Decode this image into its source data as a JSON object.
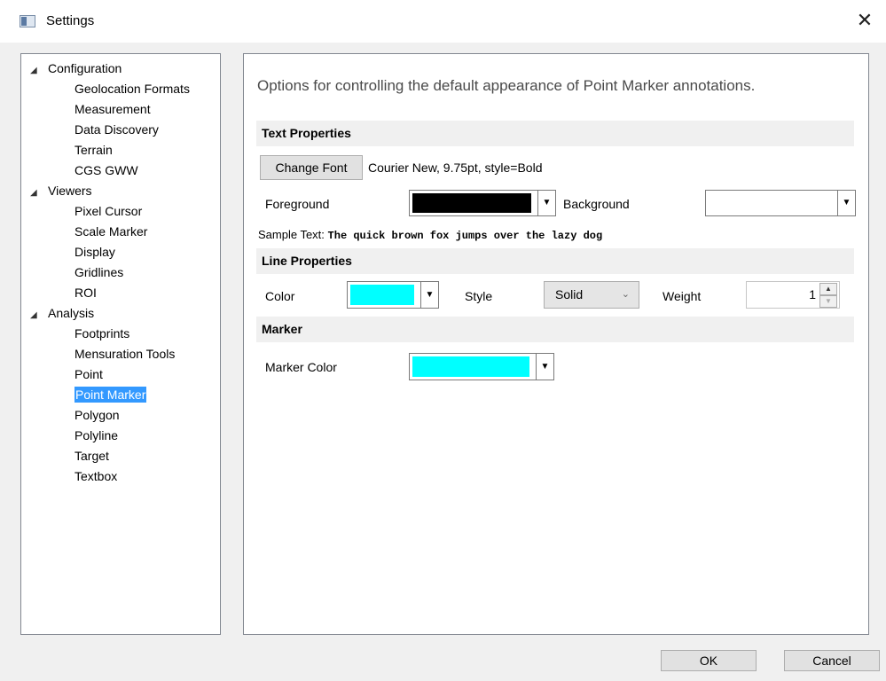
{
  "window": {
    "title": "Settings",
    "close_symbol": "✕"
  },
  "tree": {
    "items": [
      {
        "label": "Configuration",
        "level": 0,
        "expanded": true
      },
      {
        "label": "Geolocation Formats",
        "level": 1
      },
      {
        "label": "Measurement",
        "level": 1
      },
      {
        "label": "Data Discovery",
        "level": 1
      },
      {
        "label": "Terrain",
        "level": 1
      },
      {
        "label": "CGS GWW",
        "level": 1
      },
      {
        "label": "Viewers",
        "level": 0,
        "expanded": true
      },
      {
        "label": "Pixel Cursor",
        "level": 1
      },
      {
        "label": "Scale Marker",
        "level": 1
      },
      {
        "label": "Display",
        "level": 1
      },
      {
        "label": "Gridlines",
        "level": 1
      },
      {
        "label": "ROI",
        "level": 1
      },
      {
        "label": "Analysis",
        "level": 0,
        "expanded": true
      },
      {
        "label": "Footprints",
        "level": 1
      },
      {
        "label": "Mensuration Tools",
        "level": 1
      },
      {
        "label": "Point",
        "level": 1
      },
      {
        "label": "Point Marker",
        "level": 1,
        "selected": true
      },
      {
        "label": "Polygon",
        "level": 1
      },
      {
        "label": "Polyline",
        "level": 1
      },
      {
        "label": "Target",
        "level": 1
      },
      {
        "label": "Textbox",
        "level": 1
      }
    ],
    "expand_glyph": "◢"
  },
  "panel": {
    "description": "Options for controlling the default appearance of Point Marker annotations.",
    "text_properties": {
      "header": "Text Properties",
      "change_font_label": "Change Font",
      "font_info": "Courier New, 9.75pt, style=Bold",
      "foreground_label": "Foreground",
      "foreground_color": "#000000",
      "background_label": "Background",
      "background_color": "#ffffff",
      "sample_label": "Sample Text:",
      "sample_text": "The quick brown fox jumps over the lazy dog"
    },
    "line_properties": {
      "header": "Line Properties",
      "color_label": "Color",
      "color_value": "#00ffff",
      "style_label": "Style",
      "style_value": "Solid",
      "weight_label": "Weight",
      "weight_value": "1"
    },
    "marker": {
      "header": "Marker",
      "color_label": "Marker Color",
      "color_value": "#00ffff"
    }
  },
  "footer": {
    "ok_label": "OK",
    "cancel_label": "Cancel"
  },
  "colors": {
    "selection": "#3399ff",
    "window_bg": "#f0f0f0"
  }
}
